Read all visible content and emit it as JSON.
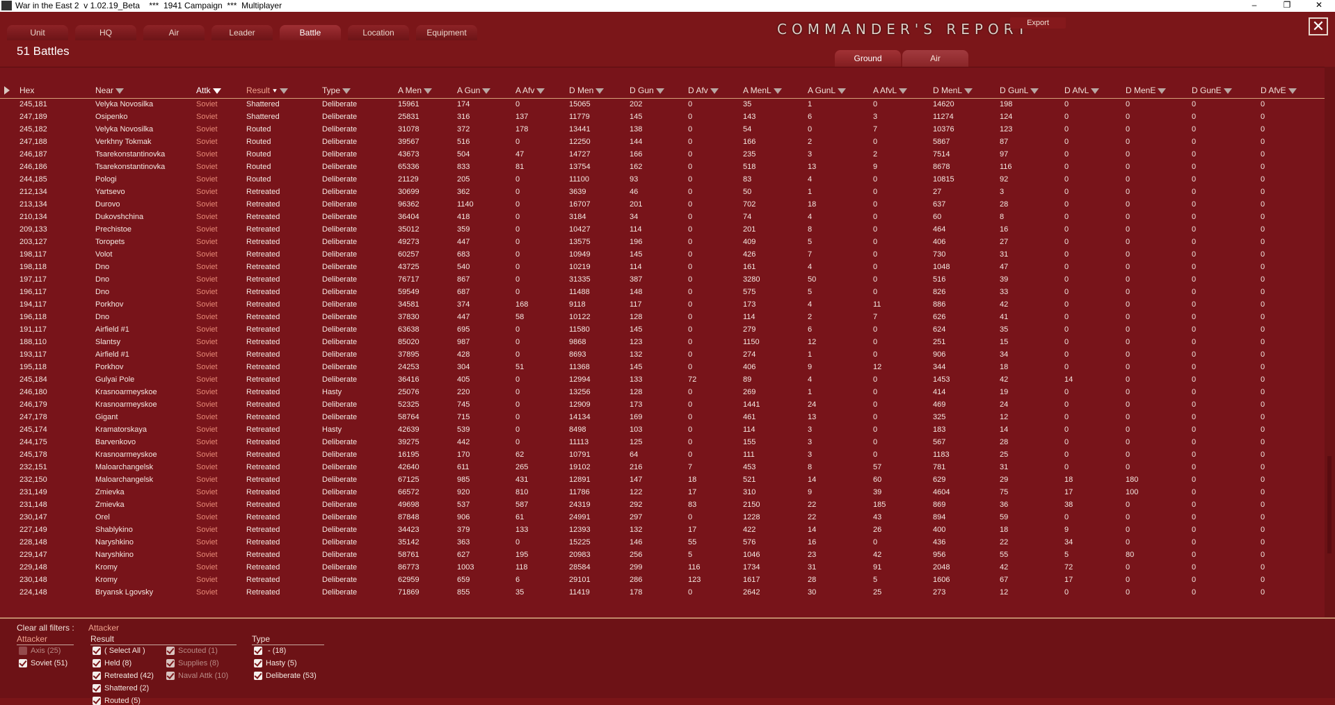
{
  "window": {
    "title": "War in the East 2  v 1.02.19_Beta    ***  1941 Campaign  ***  Multiplayer",
    "minimize": "–",
    "maximize": "❐",
    "close": "✕"
  },
  "tabs": [
    "Unit",
    "HQ",
    "Air",
    "Leader",
    "Battle",
    "Location",
    "Equipment"
  ],
  "active_tab": "Battle",
  "report_title": "COMMANDER'S   REPORT",
  "export_label": "Export",
  "close_glyph": "✕",
  "battle_count": "51 Battles",
  "subtabs": {
    "ground": "Ground",
    "air": "Air"
  },
  "columns": [
    "Hex",
    "Near",
    "Attk",
    "Result",
    "Type",
    "A Men",
    "A Gun",
    "A Afv",
    "D Men",
    "D Gun",
    "D Afv",
    "A MenL",
    "A GunL",
    "A AfvL",
    "D MenL",
    "D GunL",
    "D AfvL",
    "D MenE",
    "D GunE",
    "D AfvE"
  ],
  "rows": [
    [
      "245,181",
      "Velyka Novosilka",
      "Soviet",
      "Shattered",
      "Deliberate",
      "15961",
      "174",
      "0",
      "15065",
      "202",
      "0",
      "35",
      "1",
      "0",
      "14620",
      "198",
      "0",
      "0",
      "0",
      "0"
    ],
    [
      "247,189",
      "Osipenko",
      "Soviet",
      "Shattered",
      "Deliberate",
      "25831",
      "316",
      "137",
      "11779",
      "145",
      "0",
      "143",
      "6",
      "3",
      "11274",
      "124",
      "0",
      "0",
      "0",
      "0"
    ],
    [
      "245,182",
      "Velyka Novosilka",
      "Soviet",
      "Routed",
      "Deliberate",
      "31078",
      "372",
      "178",
      "13441",
      "138",
      "0",
      "54",
      "0",
      "7",
      "10376",
      "123",
      "0",
      "0",
      "0",
      "0"
    ],
    [
      "247,188",
      "Verkhny Tokmak",
      "Soviet",
      "Routed",
      "Deliberate",
      "39567",
      "516",
      "0",
      "12250",
      "144",
      "0",
      "166",
      "2",
      "0",
      "5867",
      "87",
      "0",
      "0",
      "0",
      "0"
    ],
    [
      "246,187",
      "Tsarekonstantinovka",
      "Soviet",
      "Routed",
      "Deliberate",
      "43673",
      "504",
      "47",
      "14727",
      "166",
      "0",
      "235",
      "3",
      "2",
      "7514",
      "97",
      "0",
      "0",
      "0",
      "0"
    ],
    [
      "246,186",
      "Tsarekonstantinovka",
      "Soviet",
      "Routed",
      "Deliberate",
      "65336",
      "833",
      "81",
      "13754",
      "162",
      "0",
      "518",
      "13",
      "9",
      "8678",
      "116",
      "0",
      "0",
      "0",
      "0"
    ],
    [
      "244,185",
      "Pologi",
      "Soviet",
      "Routed",
      "Deliberate",
      "21129",
      "205",
      "0",
      "11100",
      "93",
      "0",
      "83",
      "4",
      "0",
      "10815",
      "92",
      "0",
      "0",
      "0",
      "0"
    ],
    [
      "212,134",
      "Yartsevo",
      "Soviet",
      "Retreated",
      "Deliberate",
      "30699",
      "362",
      "0",
      "3639",
      "46",
      "0",
      "50",
      "1",
      "0",
      "27",
      "3",
      "0",
      "0",
      "0",
      "0"
    ],
    [
      "213,134",
      "Durovo",
      "Soviet",
      "Retreated",
      "Deliberate",
      "96362",
      "1140",
      "0",
      "16707",
      "201",
      "0",
      "702",
      "18",
      "0",
      "637",
      "28",
      "0",
      "0",
      "0",
      "0"
    ],
    [
      "210,134",
      "Dukovshchina",
      "Soviet",
      "Retreated",
      "Deliberate",
      "36404",
      "418",
      "0",
      "3184",
      "34",
      "0",
      "74",
      "4",
      "0",
      "60",
      "8",
      "0",
      "0",
      "0",
      "0"
    ],
    [
      "209,133",
      "Prechistoe",
      "Soviet",
      "Retreated",
      "Deliberate",
      "35012",
      "359",
      "0",
      "10427",
      "114",
      "0",
      "201",
      "8",
      "0",
      "464",
      "16",
      "0",
      "0",
      "0",
      "0"
    ],
    [
      "203,127",
      "Toropets",
      "Soviet",
      "Retreated",
      "Deliberate",
      "49273",
      "447",
      "0",
      "13575",
      "196",
      "0",
      "409",
      "5",
      "0",
      "406",
      "27",
      "0",
      "0",
      "0",
      "0"
    ],
    [
      "198,117",
      "Volot",
      "Soviet",
      "Retreated",
      "Deliberate",
      "60257",
      "683",
      "0",
      "10949",
      "145",
      "0",
      "426",
      "7",
      "0",
      "730",
      "31",
      "0",
      "0",
      "0",
      "0"
    ],
    [
      "198,118",
      "Dno",
      "Soviet",
      "Retreated",
      "Deliberate",
      "43725",
      "540",
      "0",
      "10219",
      "114",
      "0",
      "161",
      "4",
      "0",
      "1048",
      "47",
      "0",
      "0",
      "0",
      "0"
    ],
    [
      "197,117",
      "Dno",
      "Soviet",
      "Retreated",
      "Deliberate",
      "76717",
      "867",
      "0",
      "31335",
      "387",
      "0",
      "3280",
      "50",
      "0",
      "516",
      "39",
      "0",
      "0",
      "0",
      "0"
    ],
    [
      "196,117",
      "Dno",
      "Soviet",
      "Retreated",
      "Deliberate",
      "59549",
      "687",
      "0",
      "11488",
      "148",
      "0",
      "575",
      "5",
      "0",
      "826",
      "33",
      "0",
      "0",
      "0",
      "0"
    ],
    [
      "194,117",
      "Porkhov",
      "Soviet",
      "Retreated",
      "Deliberate",
      "34581",
      "374",
      "168",
      "9118",
      "117",
      "0",
      "173",
      "4",
      "11",
      "886",
      "42",
      "0",
      "0",
      "0",
      "0"
    ],
    [
      "196,118",
      "Dno",
      "Soviet",
      "Retreated",
      "Deliberate",
      "37830",
      "447",
      "58",
      "10122",
      "128",
      "0",
      "114",
      "2",
      "7",
      "626",
      "41",
      "0",
      "0",
      "0",
      "0"
    ],
    [
      "191,117",
      "Airfield #1",
      "Soviet",
      "Retreated",
      "Deliberate",
      "63638",
      "695",
      "0",
      "11580",
      "145",
      "0",
      "279",
      "6",
      "0",
      "624",
      "35",
      "0",
      "0",
      "0",
      "0"
    ],
    [
      "188,110",
      "Slantsy",
      "Soviet",
      "Retreated",
      "Deliberate",
      "85020",
      "987",
      "0",
      "9868",
      "123",
      "0",
      "1150",
      "12",
      "0",
      "251",
      "15",
      "0",
      "0",
      "0",
      "0"
    ],
    [
      "193,117",
      "Airfield #1",
      "Soviet",
      "Retreated",
      "Deliberate",
      "37895",
      "428",
      "0",
      "8693",
      "132",
      "0",
      "274",
      "1",
      "0",
      "906",
      "34",
      "0",
      "0",
      "0",
      "0"
    ],
    [
      "195,118",
      "Porkhov",
      "Soviet",
      "Retreated",
      "Deliberate",
      "24253",
      "304",
      "51",
      "11368",
      "145",
      "0",
      "406",
      "9",
      "12",
      "344",
      "18",
      "0",
      "0",
      "0",
      "0"
    ],
    [
      "245,184",
      "Gulyai Pole",
      "Soviet",
      "Retreated",
      "Deliberate",
      "36416",
      "405",
      "0",
      "12994",
      "133",
      "72",
      "89",
      "4",
      "0",
      "1453",
      "42",
      "14",
      "0",
      "0",
      "0"
    ],
    [
      "246,180",
      "Krasnoarmeyskoe",
      "Soviet",
      "Retreated",
      "Hasty",
      "25076",
      "220",
      "0",
      "13256",
      "128",
      "0",
      "269",
      "1",
      "0",
      "414",
      "19",
      "0",
      "0",
      "0",
      "0"
    ],
    [
      "246,179",
      "Krasnoarmeyskoe",
      "Soviet",
      "Retreated",
      "Deliberate",
      "52325",
      "745",
      "0",
      "12909",
      "173",
      "0",
      "1441",
      "24",
      "0",
      "469",
      "24",
      "0",
      "0",
      "0",
      "0"
    ],
    [
      "247,178",
      "Gigant",
      "Soviet",
      "Retreated",
      "Deliberate",
      "58764",
      "715",
      "0",
      "14134",
      "169",
      "0",
      "461",
      "13",
      "0",
      "325",
      "12",
      "0",
      "0",
      "0",
      "0"
    ],
    [
      "245,174",
      "Kramatorskaya",
      "Soviet",
      "Retreated",
      "Hasty",
      "42639",
      "539",
      "0",
      "8498",
      "103",
      "0",
      "114",
      "3",
      "0",
      "183",
      "14",
      "0",
      "0",
      "0",
      "0"
    ],
    [
      "244,175",
      "Barvenkovo",
      "Soviet",
      "Retreated",
      "Deliberate",
      "39275",
      "442",
      "0",
      "11113",
      "125",
      "0",
      "155",
      "3",
      "0",
      "567",
      "28",
      "0",
      "0",
      "0",
      "0"
    ],
    [
      "245,178",
      "Krasnoarmeyskoe",
      "Soviet",
      "Retreated",
      "Deliberate",
      "16195",
      "170",
      "62",
      "10791",
      "64",
      "0",
      "111",
      "3",
      "0",
      "1183",
      "25",
      "0",
      "0",
      "0",
      "0"
    ],
    [
      "232,151",
      "Maloarchangelsk",
      "Soviet",
      "Retreated",
      "Deliberate",
      "42640",
      "611",
      "265",
      "19102",
      "216",
      "7",
      "453",
      "8",
      "57",
      "781",
      "31",
      "0",
      "0",
      "0",
      "0"
    ],
    [
      "232,150",
      "Maloarchangelsk",
      "Soviet",
      "Retreated",
      "Deliberate",
      "67125",
      "985",
      "431",
      "12891",
      "147",
      "18",
      "521",
      "14",
      "60",
      "629",
      "29",
      "18",
      "180",
      "0",
      "0"
    ],
    [
      "231,149",
      "Zmievka",
      "Soviet",
      "Retreated",
      "Deliberate",
      "66572",
      "920",
      "810",
      "11786",
      "122",
      "17",
      "310",
      "9",
      "39",
      "4604",
      "75",
      "17",
      "100",
      "0",
      "0"
    ],
    [
      "231,148",
      "Zmievka",
      "Soviet",
      "Retreated",
      "Deliberate",
      "49698",
      "537",
      "587",
      "24319",
      "292",
      "83",
      "2150",
      "22",
      "185",
      "869",
      "36",
      "38",
      "0",
      "0",
      "0"
    ],
    [
      "230,147",
      "Orel",
      "Soviet",
      "Retreated",
      "Deliberate",
      "87848",
      "906",
      "61",
      "24991",
      "297",
      "0",
      "1228",
      "22",
      "43",
      "894",
      "59",
      "0",
      "0",
      "0",
      "0"
    ],
    [
      "227,149",
      "Shablykino",
      "Soviet",
      "Retreated",
      "Deliberate",
      "34423",
      "379",
      "133",
      "12393",
      "132",
      "17",
      "422",
      "14",
      "26",
      "400",
      "18",
      "9",
      "0",
      "0",
      "0"
    ],
    [
      "228,148",
      "Naryshkino",
      "Soviet",
      "Retreated",
      "Deliberate",
      "35142",
      "363",
      "0",
      "15225",
      "146",
      "55",
      "576",
      "16",
      "0",
      "436",
      "22",
      "34",
      "0",
      "0",
      "0"
    ],
    [
      "229,147",
      "Naryshkino",
      "Soviet",
      "Retreated",
      "Deliberate",
      "58761",
      "627",
      "195",
      "20983",
      "256",
      "5",
      "1046",
      "23",
      "42",
      "956",
      "55",
      "5",
      "80",
      "0",
      "0"
    ],
    [
      "229,148",
      "Kromy",
      "Soviet",
      "Retreated",
      "Deliberate",
      "86773",
      "1003",
      "118",
      "28584",
      "299",
      "116",
      "1734",
      "31",
      "91",
      "2048",
      "42",
      "72",
      "0",
      "0",
      "0"
    ],
    [
      "230,148",
      "Kromy",
      "Soviet",
      "Retreated",
      "Deliberate",
      "62959",
      "659",
      "6",
      "29101",
      "286",
      "123",
      "1617",
      "28",
      "5",
      "1606",
      "67",
      "17",
      "0",
      "0",
      "0"
    ],
    [
      "224,148",
      "Bryansk Lgovsky",
      "Soviet",
      "Retreated",
      "Deliberate",
      "71869",
      "855",
      "35",
      "11419",
      "178",
      "0",
      "2642",
      "30",
      "25",
      "273",
      "12",
      "0",
      "0",
      "0",
      "0"
    ]
  ],
  "filters": {
    "clear_label": "Clear all filters :",
    "active_label": "Attacker",
    "attacker": {
      "title": "Attacker",
      "items": [
        {
          "label": "Axis  (25)",
          "checked": false
        },
        {
          "label": "Soviet  (51)",
          "checked": true
        }
      ]
    },
    "result": {
      "title": "Result",
      "items": [
        {
          "label": "( Select All )",
          "checked": true
        },
        {
          "label": "Held  (8)",
          "checked": true
        },
        {
          "label": "Retreated  (42)",
          "checked": true
        },
        {
          "label": "Shattered  (2)",
          "checked": true
        },
        {
          "label": "Routed  (5)",
          "checked": true
        },
        {
          "label": "Scouted  (1)",
          "checked": true
        },
        {
          "label": "Supplies  (8)",
          "checked": true
        },
        {
          "label": "Naval Attk  (10)",
          "checked": true
        }
      ]
    },
    "type": {
      "title": "Type",
      "items": [
        {
          "label": " -  (18)",
          "checked": true
        },
        {
          "label": "Hasty  (5)",
          "checked": true
        },
        {
          "label": "Deliberate  (53)",
          "checked": true
        }
      ]
    }
  }
}
